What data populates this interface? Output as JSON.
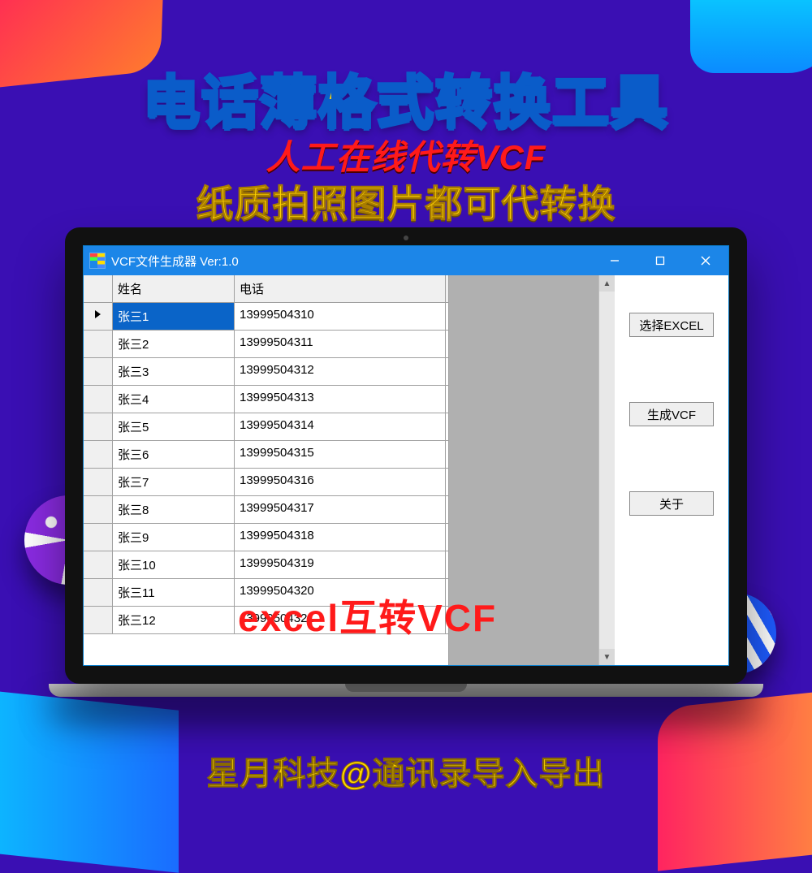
{
  "banner": {
    "title_main": "电话薄格式转换工具",
    "title_sub1": "人工在线代转VCF",
    "title_sub2": "纸质拍照图片都可代转换",
    "footer": "星月科技@通讯录导入导出",
    "overlay": "excel互转VCF"
  },
  "window": {
    "title": "VCF文件生成器  Ver:1.0",
    "columns": {
      "name": "姓名",
      "phone": "电话"
    },
    "rows": [
      {
        "name": "张三1",
        "phone": "13999504310",
        "current": true
      },
      {
        "name": "张三2",
        "phone": "13999504311"
      },
      {
        "name": "张三3",
        "phone": "13999504312"
      },
      {
        "name": "张三4",
        "phone": "13999504313"
      },
      {
        "name": "张三5",
        "phone": "13999504314"
      },
      {
        "name": "张三6",
        "phone": "13999504315"
      },
      {
        "name": "张三7",
        "phone": "13999504316"
      },
      {
        "name": "张三8",
        "phone": "13999504317"
      },
      {
        "name": "张三9",
        "phone": "13999504318"
      },
      {
        "name": "张三10",
        "phone": "13999504319"
      },
      {
        "name": "张三11",
        "phone": "13999504320"
      },
      {
        "name": "张三12",
        "phone": "13999504321"
      }
    ],
    "buttons": {
      "select_excel": "选择EXCEL",
      "gen_vcf": "生成VCF",
      "about": "关于"
    }
  }
}
